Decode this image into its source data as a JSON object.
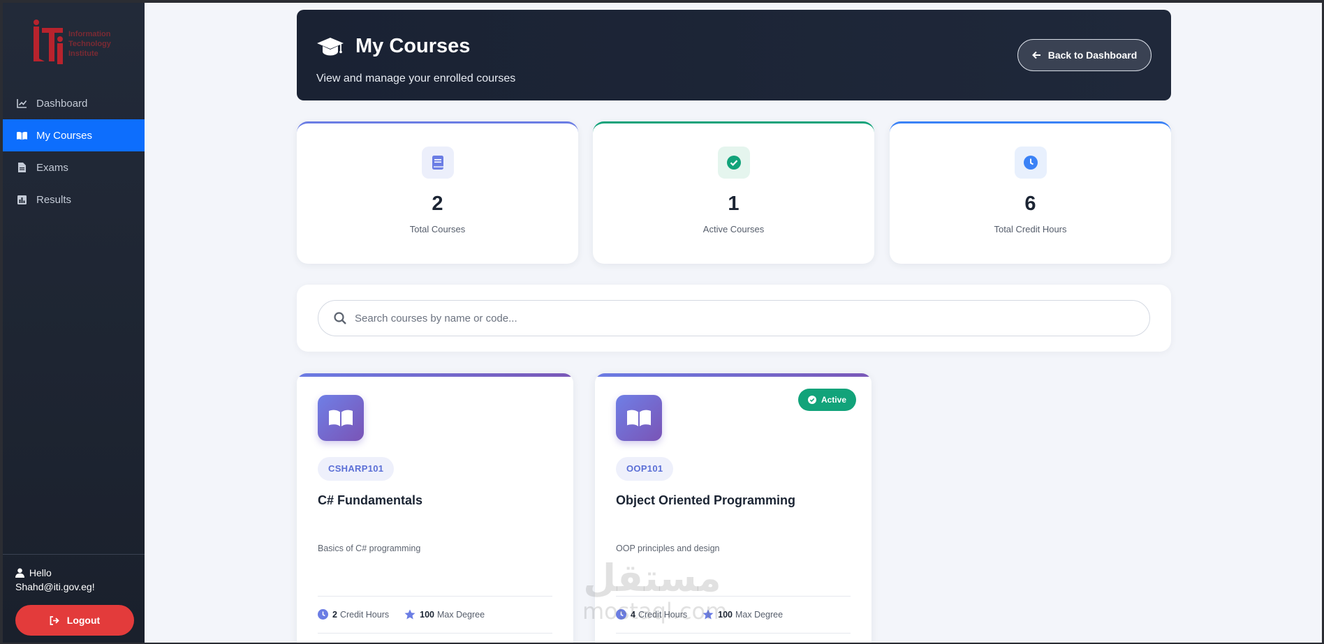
{
  "sidebar": {
    "logo_text": [
      "Information",
      "Technology",
      "Institute"
    ],
    "items": [
      {
        "label": "Dashboard",
        "icon": "chart-line-icon",
        "active": false
      },
      {
        "label": "My Courses",
        "icon": "book-open-icon",
        "active": true
      },
      {
        "label": "Exams",
        "icon": "file-icon",
        "active": false
      },
      {
        "label": "Results",
        "icon": "bar-chart-icon",
        "active": false
      }
    ],
    "hello_label": "Hello",
    "user_email": "Shahd@iti.gov.eg!",
    "logout_label": "Logout"
  },
  "header": {
    "title": "My Courses",
    "subtitle": "View and manage your enrolled courses",
    "back_label": "Back to Dashboard"
  },
  "stats": [
    {
      "value": "2",
      "label": "Total Courses",
      "icon": "book-icon"
    },
    {
      "value": "1",
      "label": "Active Courses",
      "icon": "check-circle-icon"
    },
    {
      "value": "6",
      "label": "Total Credit Hours",
      "icon": "clock-icon"
    }
  ],
  "search": {
    "placeholder": "Search courses by name or code...",
    "value": ""
  },
  "courses": [
    {
      "code": "CSHARP101",
      "title": "C# Fundamentals",
      "description": "Basics of C# programming",
      "credit_hours": "2",
      "credit_label": "Credit Hours",
      "max_degree": "100",
      "max_label": "Max Degree",
      "status": ""
    },
    {
      "code": "OOP101",
      "title": "Object Oriented Programming",
      "description": "OOP principles and design",
      "credit_hours": "4",
      "credit_label": "Credit Hours",
      "max_degree": "100",
      "max_label": "Max Degree",
      "status": "Active"
    }
  ],
  "watermark": {
    "line1": "مستقل",
    "line2": "mostaql.com"
  },
  "colors": {
    "sidebar_bg": "#1e2532",
    "active_nav": "#0d6efd",
    "header_bg": "#1a2233",
    "logout": "#e33b3b",
    "active_badge": "#12a37a",
    "accent_purple": "#6b7be3"
  }
}
